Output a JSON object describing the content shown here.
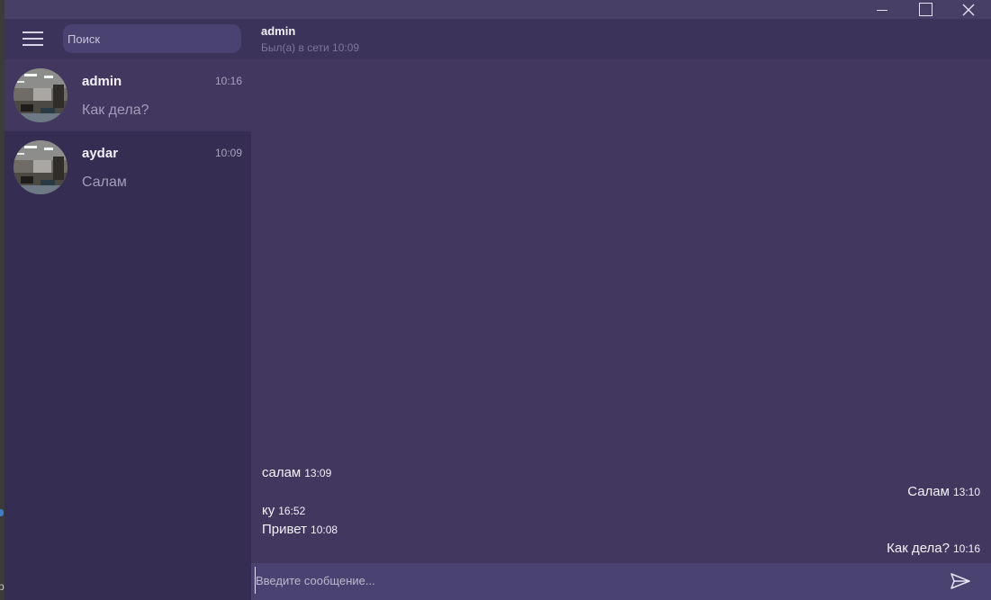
{
  "search": {
    "placeholder": "Поиск"
  },
  "chats": [
    {
      "name": "admin",
      "time": "10:16",
      "preview": "Как дела?"
    },
    {
      "name": "aydar",
      "time": "10:09",
      "preview": "Салам"
    }
  ],
  "header": {
    "name": "admin",
    "status": "Был(а) в сети 10:09"
  },
  "messages": [
    {
      "text": "салам",
      "time": "13:09",
      "side": "left"
    },
    {
      "text": "Салам",
      "time": "13:10",
      "side": "right"
    },
    {
      "text": "ку",
      "time": "16:52",
      "side": "left"
    },
    {
      "text": "Привет",
      "time": "10:08",
      "side": "left"
    },
    {
      "text": "Как дела?",
      "time": "10:16",
      "side": "right"
    }
  ],
  "composer": {
    "placeholder": "Введите сообщение..."
  },
  "desktop": {
    "edge_char": "р"
  },
  "colors": {
    "window_bg": "#41375f",
    "sidebar_bg": "#352d52",
    "header_bg": "#3b3359",
    "input_bg": "#4a4270"
  }
}
